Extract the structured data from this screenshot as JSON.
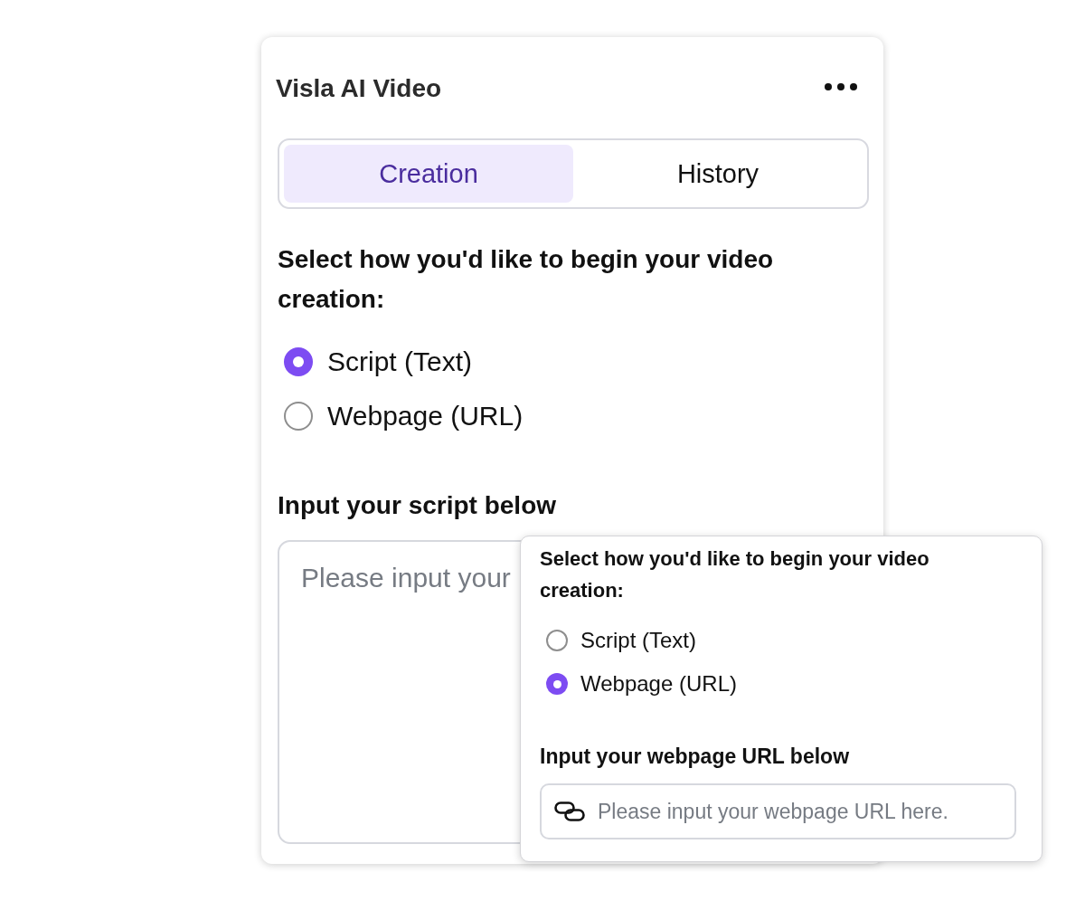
{
  "panel": {
    "title": "Visla AI Video"
  },
  "tabs": [
    {
      "label": "Creation",
      "selected": true
    },
    {
      "label": "History",
      "selected": false
    }
  ],
  "source_prompt": "Select how you'd like to begin your video creation:",
  "source_options": [
    {
      "label": "Script (Text)",
      "selected": true
    },
    {
      "label": "Webpage (URL)",
      "selected": false
    }
  ],
  "script_section": {
    "label": "Input your script below",
    "placeholder": "Please input your"
  },
  "overlay": {
    "prompt": "Select how you'd like to begin your video creation:",
    "options": [
      {
        "label": "Script (Text)",
        "selected": false
      },
      {
        "label": "Webpage (URL)",
        "selected": true
      }
    ],
    "url_label": "Input your webpage URL below",
    "url_field": {
      "placeholder": "Please input your webpage URL here."
    }
  }
}
